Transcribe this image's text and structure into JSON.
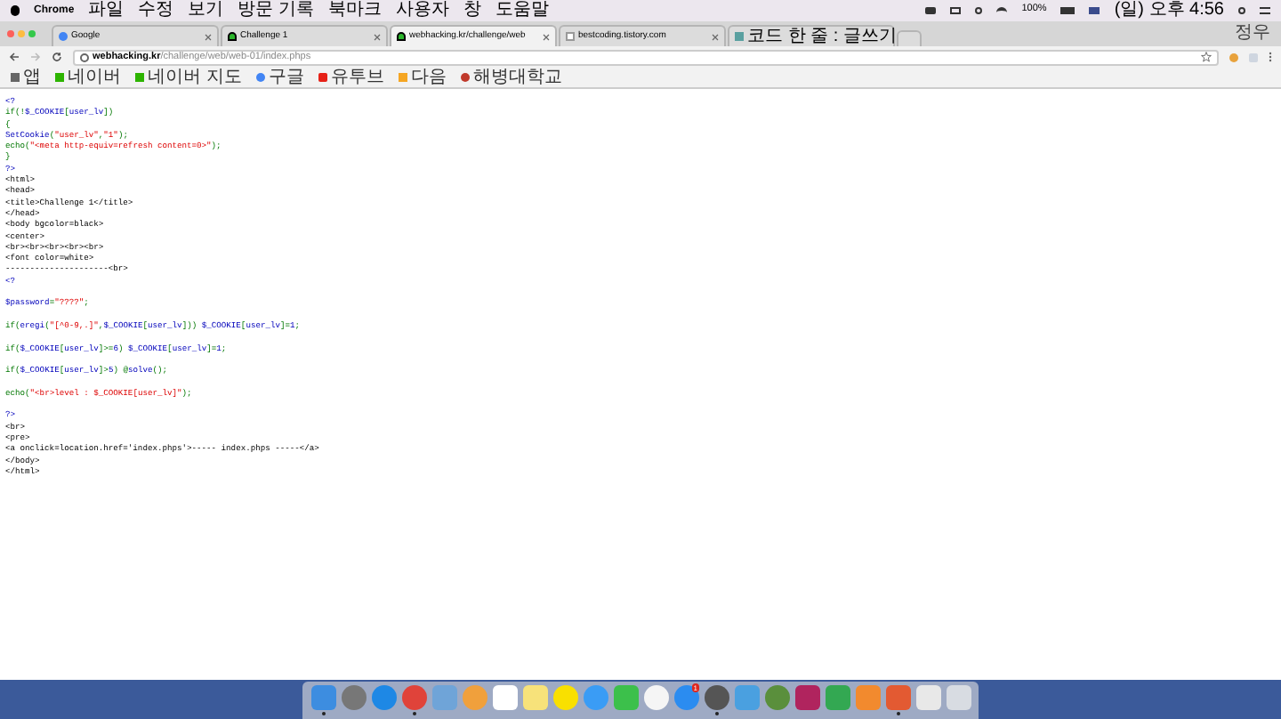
{
  "menu_bar": {
    "app": "Chrome",
    "items": [
      "파일",
      "수정",
      "보기",
      "방문 기록",
      "북마크",
      "사용자",
      "창",
      "도움말"
    ],
    "battery": "100%",
    "clock": "(일) 오후 4:56"
  },
  "tabs": [
    {
      "label": "Google",
      "selected": false,
      "kind": "google"
    },
    {
      "label": "Challenge 1",
      "selected": false,
      "kind": "challenge"
    },
    {
      "label": "webhacking.kr/challenge/web",
      "selected": true,
      "kind": "challenge"
    },
    {
      "label": "bestcoding.tistory.com",
      "selected": false,
      "kind": "page"
    },
    {
      "label": "코드 한 줄 : 글쓰기",
      "selected": false,
      "kind": "blog"
    }
  ],
  "profile": "정우",
  "address": {
    "host": "webhacking.kr",
    "path": "/challenge/web/web-01/index.phps"
  },
  "bookmarks": [
    {
      "label": "앱",
      "kind": "apps"
    },
    {
      "label": "네이버",
      "kind": "naver"
    },
    {
      "label": "네이버 지도",
      "kind": "naver"
    },
    {
      "label": "구글",
      "kind": "google"
    },
    {
      "label": "유투브",
      "kind": "youtube"
    },
    {
      "label": "다음",
      "kind": "daum"
    },
    {
      "label": "해병대학교",
      "kind": "school"
    }
  ],
  "code_lines": [
    {
      "kind": "code",
      "parts": [
        {
          "text": "<?",
          "kind": "default"
        }
      ]
    },
    {
      "kind": "code",
      "parts": [
        {
          "text": "if(!",
          "kind": "keyword"
        },
        {
          "text": "$_COOKIE",
          "kind": "default"
        },
        {
          "text": "[",
          "kind": "keyword"
        },
        {
          "text": "user_lv",
          "kind": "default"
        },
        {
          "text": "])",
          "kind": "keyword"
        }
      ]
    },
    {
      "kind": "code",
      "parts": [
        {
          "text": "{",
          "kind": "keyword"
        }
      ]
    },
    {
      "kind": "code",
      "parts": [
        {
          "text": "SetCookie",
          "kind": "default"
        },
        {
          "text": "(",
          "kind": "keyword"
        },
        {
          "text": "\"user_lv\"",
          "kind": "string"
        },
        {
          "text": ",",
          "kind": "keyword"
        },
        {
          "text": "\"1\"",
          "kind": "string"
        },
        {
          "text": ");",
          "kind": "keyword"
        }
      ]
    },
    {
      "kind": "code",
      "parts": [
        {
          "text": "echo(",
          "kind": "keyword"
        },
        {
          "text": "\"<meta http-equiv=refresh content=0>\"",
          "kind": "string"
        },
        {
          "text": ");",
          "kind": "keyword"
        }
      ]
    },
    {
      "kind": "code",
      "parts": [
        {
          "text": "}",
          "kind": "keyword"
        }
      ]
    },
    {
      "kind": "code",
      "parts": [
        {
          "text": "?>",
          "kind": "default"
        }
      ]
    },
    {
      "kind": "code",
      "parts": [
        {
          "text": "<html>",
          "kind": "html"
        }
      ]
    },
    {
      "kind": "code",
      "parts": [
        {
          "text": "<head>",
          "kind": "html"
        }
      ]
    },
    {
      "kind": "code",
      "parts": [
        {
          "text": "<title>Challenge 1</title>",
          "kind": "html"
        }
      ]
    },
    {
      "kind": "code",
      "parts": [
        {
          "text": "</head>",
          "kind": "html"
        }
      ]
    },
    {
      "kind": "code",
      "parts": [
        {
          "text": "<body bgcolor=black>",
          "kind": "html"
        }
      ]
    },
    {
      "kind": "code",
      "parts": [
        {
          "text": "<center>",
          "kind": "html"
        }
      ]
    },
    {
      "kind": "code",
      "parts": [
        {
          "text": "<br><br><br><br><br>",
          "kind": "html"
        }
      ]
    },
    {
      "kind": "code",
      "parts": [
        {
          "text": "<font color=white>",
          "kind": "html"
        }
      ]
    },
    {
      "kind": "code",
      "parts": [
        {
          "text": "---------------------<br>",
          "kind": "html"
        }
      ]
    },
    {
      "kind": "code",
      "parts": [
        {
          "text": "<?",
          "kind": "default"
        }
      ]
    },
    {
      "kind": "blank"
    },
    {
      "kind": "code",
      "parts": [
        {
          "text": "$password",
          "kind": "default"
        },
        {
          "text": "=",
          "kind": "keyword"
        },
        {
          "text": "\"????\"",
          "kind": "string"
        },
        {
          "text": ";",
          "kind": "keyword"
        }
      ]
    },
    {
      "kind": "blank"
    },
    {
      "kind": "code",
      "parts": [
        {
          "text": "if(",
          "kind": "keyword"
        },
        {
          "text": "eregi",
          "kind": "default"
        },
        {
          "text": "(",
          "kind": "keyword"
        },
        {
          "text": "\"[^0-9,.]\"",
          "kind": "string"
        },
        {
          "text": ",",
          "kind": "keyword"
        },
        {
          "text": "$_COOKIE",
          "kind": "default"
        },
        {
          "text": "[",
          "kind": "keyword"
        },
        {
          "text": "user_lv",
          "kind": "default"
        },
        {
          "text": "])) ",
          "kind": "keyword"
        },
        {
          "text": "$_COOKIE",
          "kind": "default"
        },
        {
          "text": "[",
          "kind": "keyword"
        },
        {
          "text": "user_lv",
          "kind": "default"
        },
        {
          "text": "]=",
          "kind": "keyword"
        },
        {
          "text": "1",
          "kind": "default"
        },
        {
          "text": ";",
          "kind": "keyword"
        }
      ]
    },
    {
      "kind": "blank"
    },
    {
      "kind": "code",
      "parts": [
        {
          "text": "if(",
          "kind": "keyword"
        },
        {
          "text": "$_COOKIE",
          "kind": "default"
        },
        {
          "text": "[",
          "kind": "keyword"
        },
        {
          "text": "user_lv",
          "kind": "default"
        },
        {
          "text": "]>=",
          "kind": "keyword"
        },
        {
          "text": "6",
          "kind": "default"
        },
        {
          "text": ") ",
          "kind": "keyword"
        },
        {
          "text": "$_COOKIE",
          "kind": "default"
        },
        {
          "text": "[",
          "kind": "keyword"
        },
        {
          "text": "user_lv",
          "kind": "default"
        },
        {
          "text": "]=",
          "kind": "keyword"
        },
        {
          "text": "1",
          "kind": "default"
        },
        {
          "text": ";",
          "kind": "keyword"
        }
      ]
    },
    {
      "kind": "blank"
    },
    {
      "kind": "code",
      "parts": [
        {
          "text": "if(",
          "kind": "keyword"
        },
        {
          "text": "$_COOKIE",
          "kind": "default"
        },
        {
          "text": "[",
          "kind": "keyword"
        },
        {
          "text": "user_lv",
          "kind": "default"
        },
        {
          "text": "]>",
          "kind": "keyword"
        },
        {
          "text": "5",
          "kind": "default"
        },
        {
          "text": ") @",
          "kind": "keyword"
        },
        {
          "text": "solve",
          "kind": "default"
        },
        {
          "text": "();",
          "kind": "keyword"
        }
      ]
    },
    {
      "kind": "blank"
    },
    {
      "kind": "code",
      "parts": [
        {
          "text": "echo(",
          "kind": "keyword"
        },
        {
          "text": "\"<br>level : $_COOKIE[user_lv]\"",
          "kind": "string"
        },
        {
          "text": ");",
          "kind": "keyword"
        }
      ]
    },
    {
      "kind": "blank"
    },
    {
      "kind": "code",
      "parts": [
        {
          "text": "?>",
          "kind": "default"
        }
      ]
    },
    {
      "kind": "code",
      "parts": [
        {
          "text": "<br>",
          "kind": "html"
        }
      ]
    },
    {
      "kind": "code",
      "parts": [
        {
          "text": "<pre>",
          "kind": "html"
        }
      ]
    },
    {
      "kind": "code",
      "parts": [
        {
          "text": "<a onclick=location.href='index.phps'>----- index.phps -----</a>",
          "kind": "html"
        }
      ]
    },
    {
      "kind": "code",
      "parts": [
        {
          "text": "</body>",
          "kind": "html"
        }
      ]
    },
    {
      "kind": "code",
      "parts": [
        {
          "text": "</html>",
          "kind": "html"
        }
      ]
    }
  ],
  "dock": [
    {
      "kind": "finder",
      "running": true
    },
    {
      "kind": "launchpad",
      "running": false
    },
    {
      "kind": "safari",
      "running": false
    },
    {
      "kind": "chrome",
      "running": true
    },
    {
      "kind": "preview",
      "running": false
    },
    {
      "kind": "photos",
      "running": false
    },
    {
      "kind": "calendar",
      "running": false
    },
    {
      "kind": "notes",
      "running": false
    },
    {
      "kind": "kakao",
      "running": false
    },
    {
      "kind": "messages",
      "running": false
    },
    {
      "kind": "facetime",
      "running": false
    },
    {
      "kind": "music",
      "running": false
    },
    {
      "kind": "appstore",
      "running": false,
      "badge": "1"
    },
    {
      "kind": "settings",
      "running": true
    },
    {
      "kind": "book",
      "running": false
    },
    {
      "kind": "android",
      "running": false
    },
    {
      "kind": "intellij",
      "running": false
    },
    {
      "kind": "pycharm",
      "running": false
    },
    {
      "kind": "sublime",
      "running": false
    },
    {
      "kind": "git",
      "running": true
    },
    {
      "kind": "doc",
      "running": false
    },
    {
      "kind": "trash",
      "running": false
    }
  ]
}
